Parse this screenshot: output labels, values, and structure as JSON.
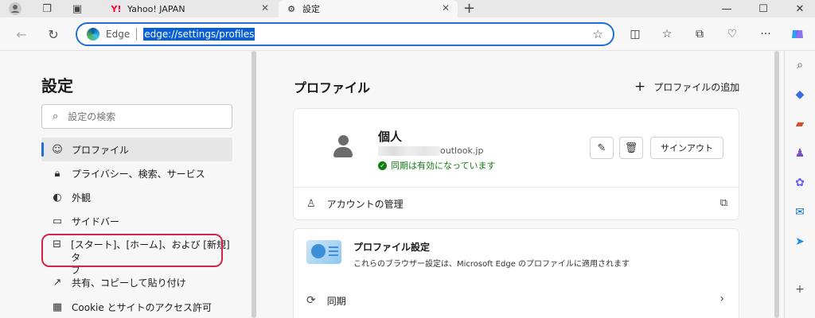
{
  "browser": {
    "tabs": [
      {
        "label": "Yahoo! JAPAN",
        "favicon": "Y!"
      },
      {
        "label": "設定",
        "favicon": "gear-icon"
      }
    ],
    "address": {
      "brand": "Edge",
      "url": "edge://settings/profiles"
    }
  },
  "settings_nav": {
    "title": "設定",
    "search_placeholder": "設定の検索",
    "items": [
      {
        "label": "プロファイル",
        "icon": "profile-icon"
      },
      {
        "label": "プライバシー、検索、サービス",
        "icon": "lock-icon"
      },
      {
        "label": "外観",
        "icon": "palette-icon"
      },
      {
        "label": "サイドバー",
        "icon": "sidebar-icon"
      },
      {
        "label": "[スタート]、[ホーム]、および [新規] タブ",
        "label_line1": "[スタート]、[ホーム]、および [新規] タ",
        "label_line2": "ブ",
        "icon": "newtab-icon"
      },
      {
        "label": "共有、コピーして貼り付け",
        "icon": "share-icon"
      },
      {
        "label": "Cookie とサイトのアクセス許可",
        "icon": "cookie-icon"
      }
    ]
  },
  "main": {
    "heading": "プロファイル",
    "add_profile": "プロファイルの追加",
    "profile": {
      "name": "個人",
      "email_suffix": "outlook.jp",
      "sync_status": "同期は有効になっています",
      "signout_label": "サインアウト"
    },
    "account_manage": "アカウントの管理",
    "profile_settings": {
      "title": "プロファイル設定",
      "description": "これらのブラウザー設定は、Microsoft Edge のプロファイルに適用されます"
    },
    "sync_label": "同期"
  },
  "colors": {
    "accent": "#1f6fd6",
    "highlight_ring": "#d0264c",
    "sync_green": "#107c10"
  }
}
